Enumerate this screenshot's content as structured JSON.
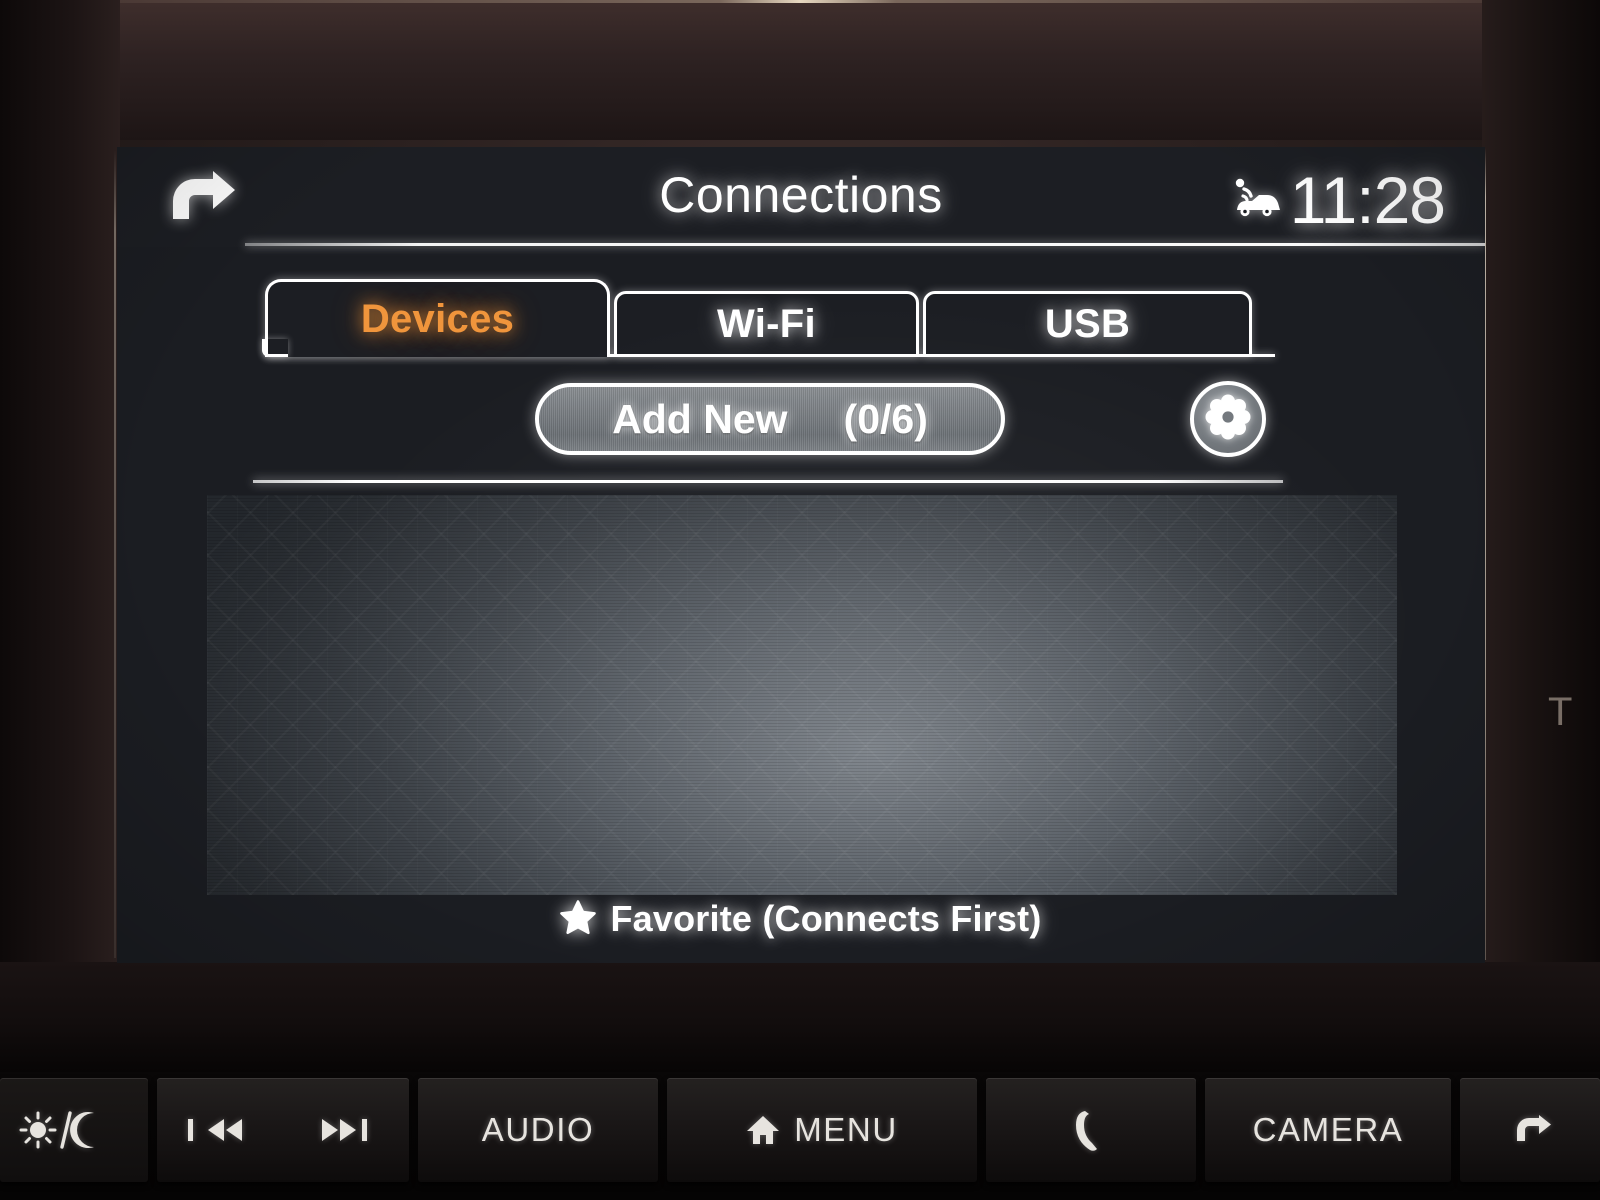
{
  "screen": {
    "header": {
      "back_icon": "back-arrow-icon",
      "title": "Connections",
      "status": {
        "connected_car_icon": "connected-car-icon",
        "clock": "11:28"
      }
    },
    "tabs": [
      {
        "id": "devices",
        "label": "Devices",
        "active": true,
        "color": "#f0953c"
      },
      {
        "id": "wifi",
        "label": "Wi-Fi",
        "active": false,
        "color": "#ffffff"
      },
      {
        "id": "usb",
        "label": "USB",
        "active": false,
        "color": "#ffffff"
      }
    ],
    "actions": {
      "add_new_label": "Add New",
      "add_new_count": "(0/6)",
      "settings_icon": "gear-icon"
    },
    "device_list": {
      "items": [],
      "empty_text": ""
    },
    "footer": {
      "star_icon": "star-icon",
      "legend": "Favorite (Connects First)"
    }
  },
  "hardware_buttons": [
    {
      "id": "brightness",
      "label": "",
      "icon": "sun-moon-icon"
    },
    {
      "id": "track",
      "label": "",
      "icon": "prev-next-track-icon"
    },
    {
      "id": "audio",
      "label": "AUDIO",
      "icon": ""
    },
    {
      "id": "menu",
      "label": "MENU",
      "icon": "home-icon"
    },
    {
      "id": "phone",
      "label": "",
      "icon": "phone-icon"
    },
    {
      "id": "camera",
      "label": "CAMERA",
      "icon": ""
    },
    {
      "id": "back",
      "label": "",
      "icon": "back-arrow-icon"
    }
  ],
  "dash": {
    "edge_mark": "T"
  },
  "colors": {
    "accent": "#f0953c",
    "text": "#ffffff",
    "screen_bg": "#1c1e23",
    "pill_fill": "#787d82"
  }
}
